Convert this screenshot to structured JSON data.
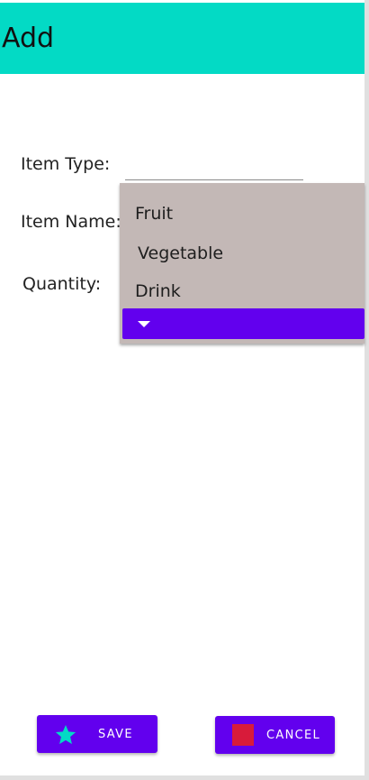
{
  "app_bar": {
    "title": "Add",
    "color": "#03dac5"
  },
  "form": {
    "item_type_label": "Item Type:",
    "item_name_label": "Item Name:",
    "quantity_label": "Quantity:"
  },
  "dropdown": {
    "options": [
      "Fruit",
      "Vegetable",
      "Drink"
    ],
    "background": "#c3b8b6",
    "footer_icon": "caret-down-icon"
  },
  "buttons": {
    "save_label": "SAVE",
    "save_icon": "star-icon",
    "cancel_label": "CANCEL",
    "cancel_icon": "cancel-icon",
    "color": "#6200ee"
  }
}
